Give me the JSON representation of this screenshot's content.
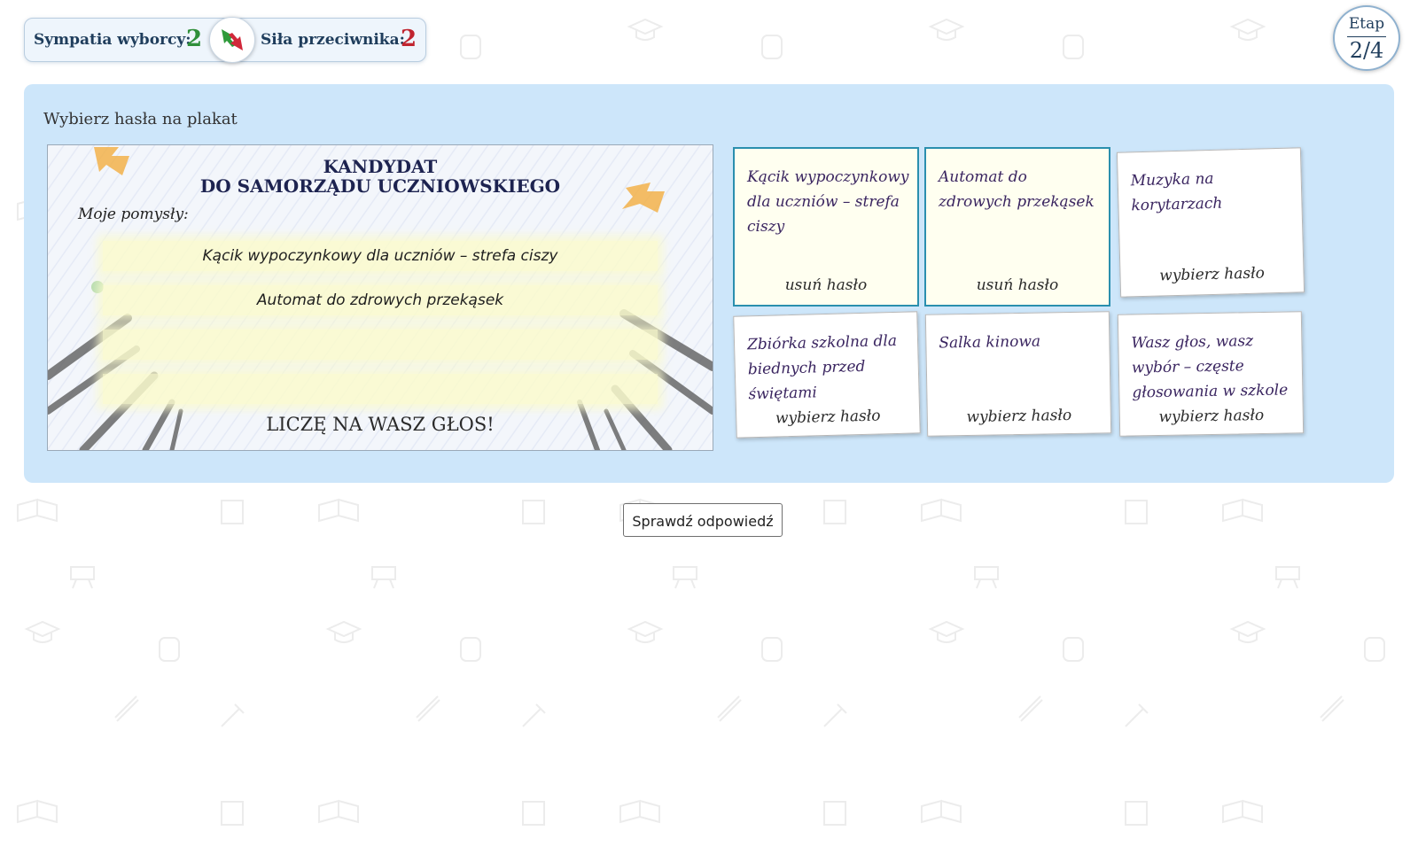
{
  "stats": {
    "sympathy_label": "Sympatia wyborcy:",
    "sympathy_value": "2",
    "opponent_label": "Siła przeciwnika:",
    "opponent_value": "2",
    "swap_icon": "swap-arrows-icon"
  },
  "stage": {
    "label": "Etap",
    "value": "2/4"
  },
  "task": {
    "instruction": "Wybierz hasła na plakat"
  },
  "poster": {
    "title_line1": "KANDYDAT",
    "title_line2": "DO SAMORZĄDU UCZNIOWSKIEGO",
    "ideas_label": "Moje pomysły:",
    "slots": [
      "Kącik wypoczynkowy dla uczniów – strefa ciszy",
      "Automat do zdrowych przekąsek",
      "",
      ""
    ],
    "footer": "LICZĘ NA WASZ GŁOS!"
  },
  "cards": [
    {
      "text": "Kącik wypoczynkowy dla uczniów – strefa ciszy",
      "action": "usuń hasło",
      "selected": true
    },
    {
      "text": "Automat do zdrowych przekąsek",
      "action": "usuń hasło",
      "selected": true
    },
    {
      "text": "Muzyka na korytarzach",
      "action": "wybierz hasło",
      "selected": false
    },
    {
      "text": "Zbiórka szkolna dla biednych przed świętami",
      "action": "wybierz hasło",
      "selected": false
    },
    {
      "text": "Salka kinowa",
      "action": "wybierz hasło",
      "selected": false
    },
    {
      "text": "Wasz głos, wasz wybór – częste głosowania w szkole",
      "action": "wybierz hasło",
      "selected": false
    }
  ],
  "check_button": "Sprawdź odpowiedź",
  "colors": {
    "panel": "#cde6fa",
    "sympathy": "#2f8f3a",
    "opponent": "#c0242f",
    "selected_border": "#2a8fae"
  }
}
